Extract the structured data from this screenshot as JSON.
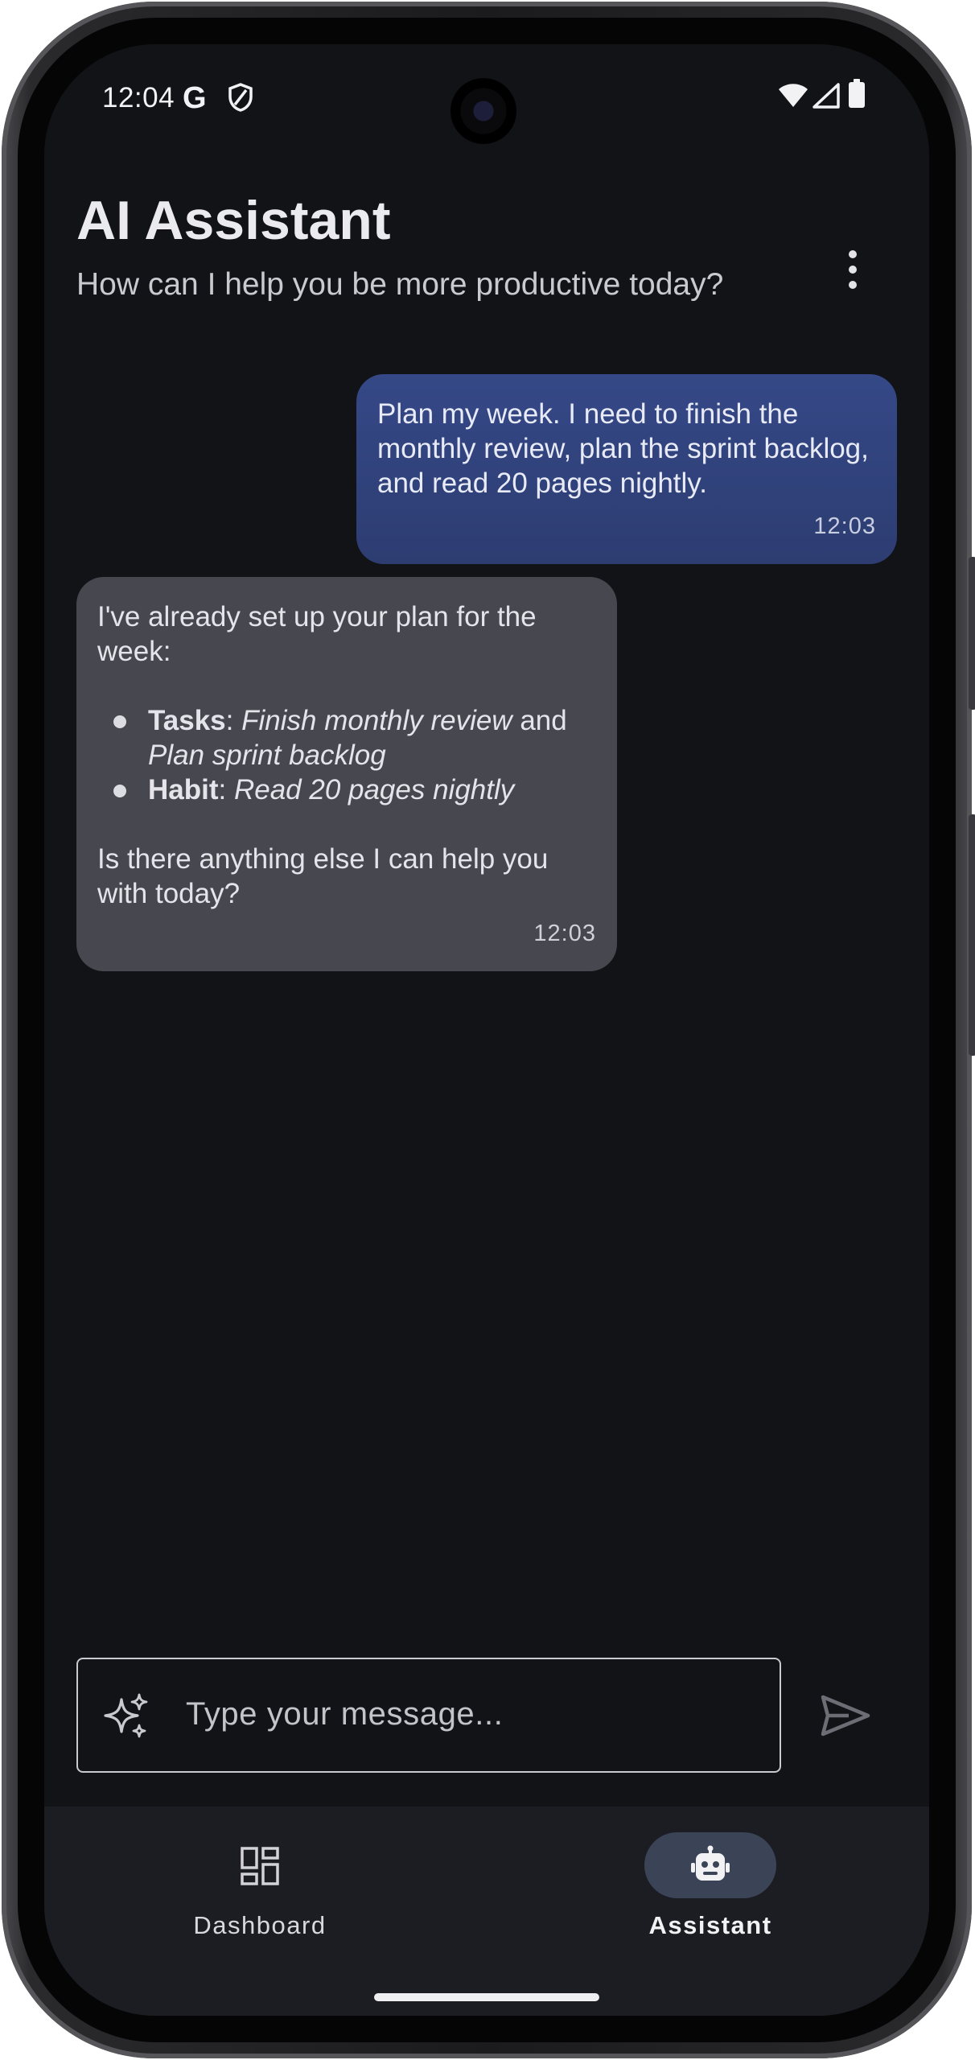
{
  "status_bar": {
    "time": "12:04",
    "g_label": "G",
    "icons": [
      "shield-icon",
      "wifi-icon",
      "signal-icon",
      "battery-icon"
    ]
  },
  "header": {
    "title": "AI Assistant",
    "subtitle": "How can I help you be more productive today?",
    "menu_icon": "more-vert-icon"
  },
  "messages": [
    {
      "sender": "user",
      "text": "Plan my week. I need to finish the monthly review, plan the sprint backlog, and read 20 pages nightly.",
      "time": "12:03"
    },
    {
      "sender": "assistant",
      "intro": "I've already set up your plan for the week:",
      "items": [
        {
          "label": "Tasks",
          "sep": ": ",
          "part1": "Finish monthly review",
          "joiner": " and ",
          "part2": "Plan sprint backlog"
        },
        {
          "label": "Habit",
          "sep": ": ",
          "part1": "Read 20 pages nightly"
        }
      ],
      "outro": "Is there anything else I can help you with today?",
      "time": "12:03"
    }
  ],
  "composer": {
    "placeholder": "Type your message...",
    "leading_icon": "sparkle-icon",
    "send_icon": "send-icon"
  },
  "nav": {
    "items": [
      {
        "label": "Dashboard",
        "icon": "dashboard-icon",
        "selected": false
      },
      {
        "label": "Assistant",
        "icon": "robot-icon",
        "selected": true
      }
    ]
  },
  "colors": {
    "background": "#121316",
    "user_bubble": "#354887",
    "assistant_bubble": "#47474f",
    "nav_background": "#1c1d22",
    "nav_selected_pill": "#3b4457"
  }
}
